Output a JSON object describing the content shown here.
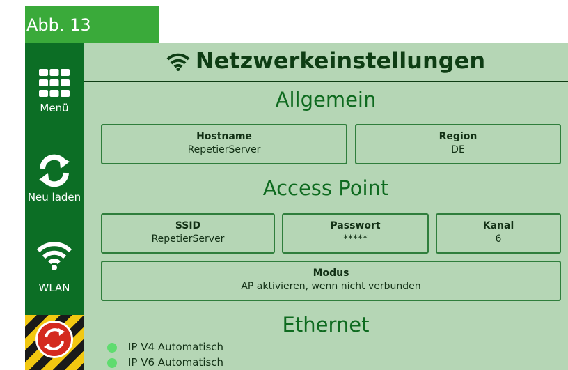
{
  "figure_label": "Abb. 13",
  "sidebar": {
    "menu": {
      "icon": "grid-menu-icon",
      "label": "Menü"
    },
    "reload": {
      "icon": "refresh-icon",
      "label": "Neu laden"
    },
    "wlan": {
      "icon": "wifi-icon",
      "label": "WLAN"
    },
    "emergency_stop": {
      "icon": "emergency-stop-icon"
    }
  },
  "header": {
    "icon": "wifi-icon",
    "title": "Netzwerkeinstellungen"
  },
  "general": {
    "heading": "Allgemein",
    "hostname": {
      "label": "Hostname",
      "value": "RepetierServer"
    },
    "region": {
      "label": "Region",
      "value": "DE"
    }
  },
  "access_point": {
    "heading": "Access Point",
    "ssid": {
      "label": "SSID",
      "value": "RepetierServer"
    },
    "password": {
      "label": "Passwort",
      "value": "*****"
    },
    "channel": {
      "label": "Kanal",
      "value": "6"
    },
    "mode": {
      "label": "Modus",
      "value": "AP aktivieren, wenn nicht verbunden"
    }
  },
  "ethernet": {
    "heading": "Ethernet",
    "ipv4": "IP V4 Automatisch",
    "ipv6": "IP V6 Automatisch"
  },
  "colors": {
    "sidebar": "#0c6e25",
    "screen_bg": "#b5d6b5",
    "tag_bg": "#3aaa3a",
    "field_border": "#2f7e3c",
    "status_dot": "#5fdc6f"
  }
}
